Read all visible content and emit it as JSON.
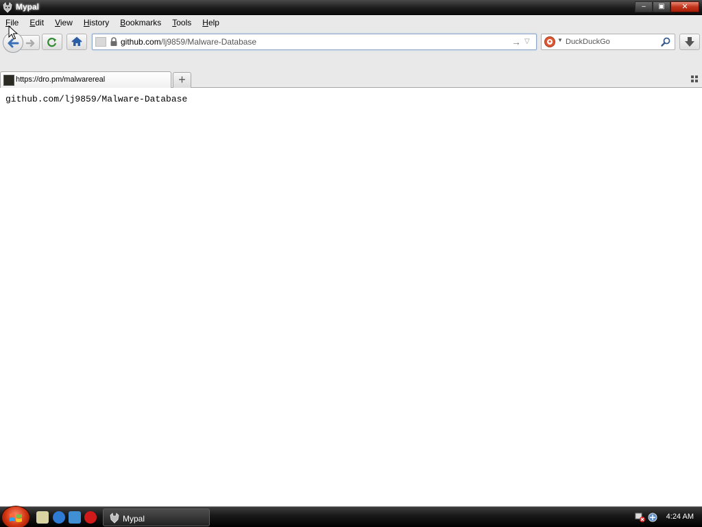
{
  "window": {
    "title": "Mypal",
    "buttons": {
      "minimize": "–",
      "restore": "▣",
      "close": "✕"
    }
  },
  "menubar": {
    "items": [
      "File",
      "Edit",
      "View",
      "History",
      "Bookmarks",
      "Tools",
      "Help"
    ]
  },
  "navbar": {
    "url_host": "github.com",
    "url_path": "/lj9859/Malware-Database",
    "go_glyph": "→",
    "dropmarker_glyph": "▽"
  },
  "search": {
    "placeholder": "DuckDuckGo",
    "engine_dropdown_glyph": "▼"
  },
  "tabs": [
    {
      "title": "https://dro.pm/malwarereal"
    }
  ],
  "newtab_glyph": "+",
  "page": {
    "text": "github.com/lj9859/Malware-Database"
  },
  "taskbar": {
    "task_label": "Mypal",
    "clock": "4:24 AM"
  },
  "colors": {
    "accent": "#1e5cbf",
    "close_button": "#c2351c",
    "duckduckgo": "#de5833"
  },
  "icons": {
    "window": "mypal-app-icon",
    "back": "back-arrow-icon",
    "forward": "forward-arrow-icon",
    "reload": "reload-icon",
    "home": "home-icon",
    "lock": "lock-icon",
    "search": "magnifier-icon",
    "download": "download-arrow-icon",
    "all_tabs": "grid-icon"
  }
}
